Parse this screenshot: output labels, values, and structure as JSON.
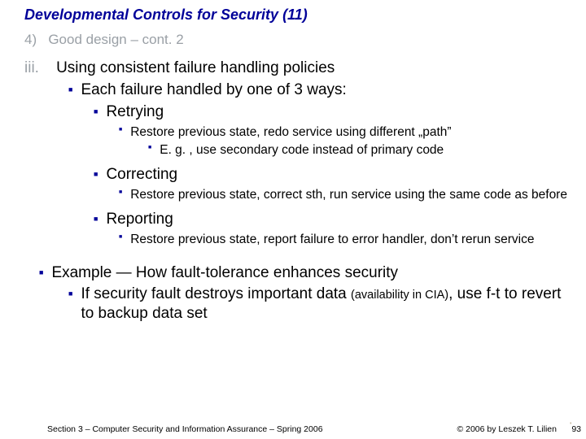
{
  "title": "Developmental Controls for Security (11)",
  "heading4": {
    "num": "4)",
    "text": "Good design – cont. 2"
  },
  "roman3": {
    "num": "iii.",
    "text": "Using consistent failure handling policies"
  },
  "each": "Each failure handled by one of 3 ways:",
  "retrying": {
    "label": "Retrying",
    "sub1": "Restore previous state, redo service using different „path”",
    "sub2": "E. g. , use secondary code instead of primary code"
  },
  "correcting": {
    "label": "Correcting",
    "sub1": "Restore previous state, correct sth, run service using the same code as before"
  },
  "reporting": {
    "label": "Reporting",
    "sub1": "Restore previous state, report failure to error handler, don’t rerun service"
  },
  "example": {
    "lead": "Example — How fault-tolerance enhances security",
    "body_pre": "If security fault destroys important data ",
    "body_paren": "(availability in CIA)",
    "body_post": ", use f-t to revert to backup data set"
  },
  "footer": {
    "left": "Section 3 – Computer Security and Information Assurance – Spring 2006",
    "right": "© 2006 by Leszek T. Lilien"
  },
  "page": "93",
  "bullet": "■"
}
